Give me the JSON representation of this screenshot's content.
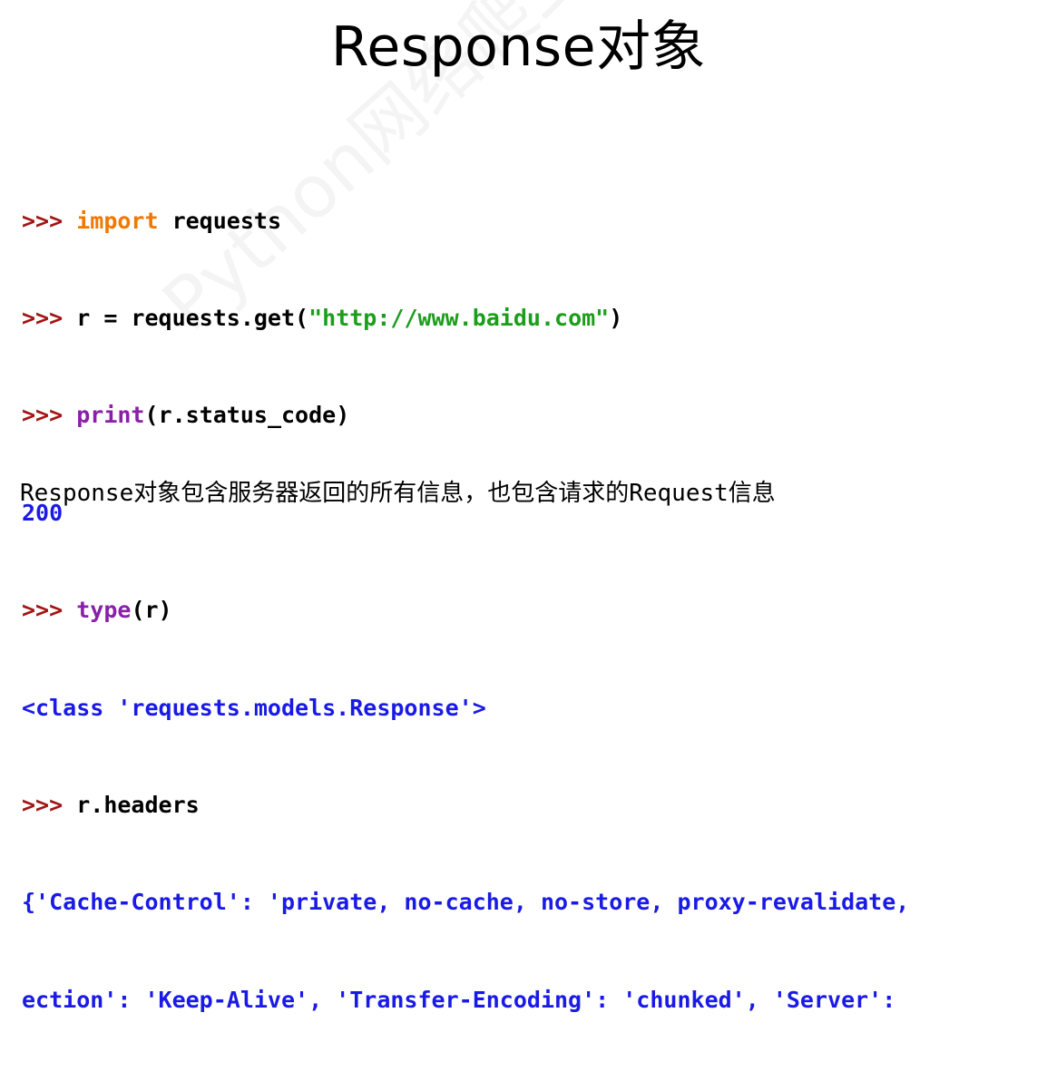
{
  "slide": {
    "title": "Response对象",
    "watermark": "Python网络爬虫与信息提取",
    "description": "Response对象包含服务器返回的所有信息，也包含请求的Request信息"
  },
  "code": {
    "line1": {
      "prompt": ">>> ",
      "keyword": "import",
      "rest": " requests"
    },
    "line2": {
      "prompt": ">>> ",
      "pre": "r = requests.get(",
      "string": "\"http://www.baidu.com\"",
      "post": ")"
    },
    "line3": {
      "prompt": ">>> ",
      "func": "print",
      "rest": "(r.status_code)"
    },
    "line4": {
      "output": "200"
    },
    "line5": {
      "prompt": ">>> ",
      "func": "type",
      "rest": "(r)"
    },
    "line6": {
      "output": "<class 'requests.models.Response'>"
    },
    "line7": {
      "prompt": ">>> ",
      "rest": "r.headers"
    },
    "line8": {
      "output": "{'Cache-Control': 'private, no-cache, no-store, proxy-revalidate,"
    },
    "line9": {
      "output": "ection': 'Keep-Alive', 'Transfer-Encoding': 'chunked', 'Server':"
    }
  },
  "colors": {
    "prompt": "#a31414",
    "keyword": "#f07800",
    "builtin": "#8a1fa8",
    "string": "#1b9e1b",
    "output": "#1a1ae6"
  }
}
